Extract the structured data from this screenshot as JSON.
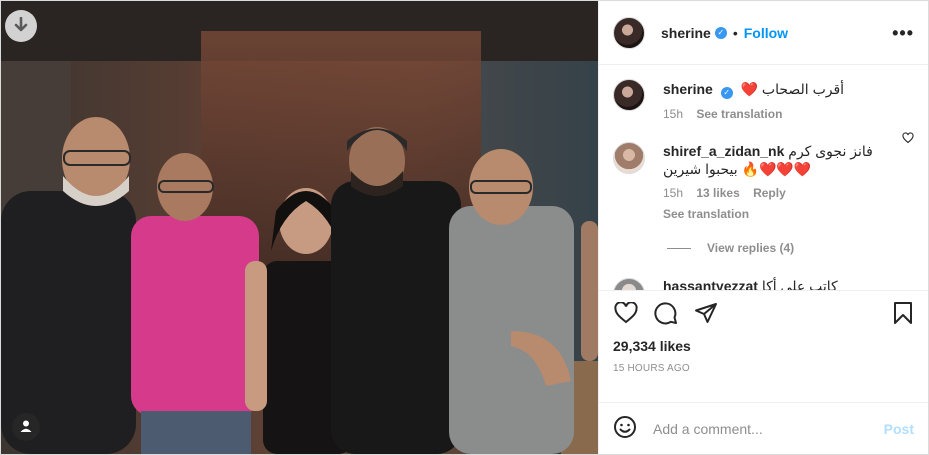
{
  "header": {
    "username": "sherine",
    "separator": "•",
    "follow_label": "Follow",
    "more_label": "•••"
  },
  "caption": {
    "username": "sherine",
    "text": "أقرب الصحاب ❤️",
    "age": "15h",
    "see_translation": "See translation"
  },
  "comment": {
    "username": "shiref_a_zidan_nk",
    "text": "فانز نجوى كرم ❤️❤️❤️🔥 بيحبوا شيرين",
    "age": "15h",
    "likes": "13 likes",
    "reply": "Reply",
    "see_translation": "See translation",
    "view_replies": "View replies (4)"
  },
  "next_comment": {
    "username": "hassantyezzat",
    "text": "كاتب على أكا"
  },
  "stats": {
    "likes": "29,334 likes",
    "time": "15 HOURS AGO"
  },
  "composer": {
    "placeholder": "Add a comment...",
    "post_label": "Post"
  },
  "colors": {
    "accent": "#0095f6",
    "verified": "#3897f0",
    "muted": "#8e8e8e",
    "post_disabled": "#b2dffc"
  },
  "icons": [
    "download-icon",
    "verified-badge-icon",
    "more-options-icon",
    "heart-icon",
    "comment-icon",
    "share-icon",
    "bookmark-icon",
    "emoji-icon",
    "user-tag-icon"
  ]
}
